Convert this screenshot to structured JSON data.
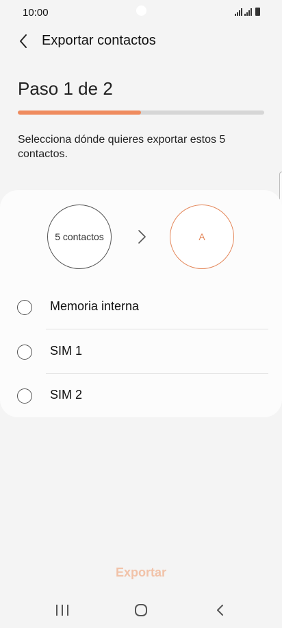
{
  "status_bar": {
    "time": "10:00"
  },
  "header": {
    "title": "Exportar contactos",
    "back_icon": "back-arrow-icon"
  },
  "step": {
    "title": "Paso 1 de 2",
    "progress": 0.5
  },
  "description": "Selecciona dónde quieres exportar estos 5 contactos.",
  "transfer": {
    "source_label": "5 contactos",
    "destination_label": "A"
  },
  "options": [
    {
      "label": "Memoria interna",
      "selected": false
    },
    {
      "label": "SIM 1",
      "selected": false
    },
    {
      "label": "SIM 2",
      "selected": false
    }
  ],
  "export_button": {
    "label": "Exportar",
    "enabled": false
  },
  "colors": {
    "accent": "#ef8b5e",
    "disabled_button_text": "#f1c2a8",
    "background": "#f4f4f4"
  }
}
